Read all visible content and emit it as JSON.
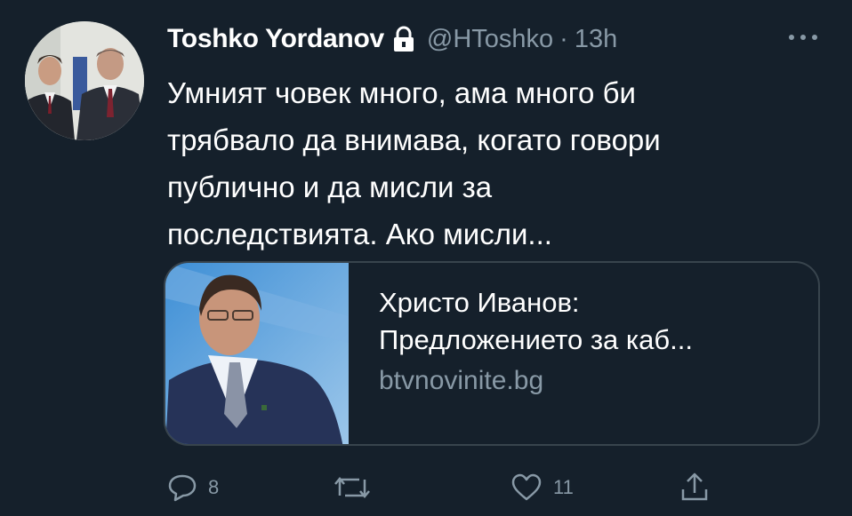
{
  "tweet": {
    "author": {
      "display_name": "Toshko Yordanov",
      "handle": "@HToshko",
      "separator": "·",
      "time": "13h",
      "protected_icon": "lock-icon",
      "avatar": "profile-photo"
    },
    "text_lines": [
      "Умният човек много, ама много би",
      "трябвало да внимава, когато говори",
      "публично и да мисли за",
      "последствията. Ако мисли..."
    ],
    "more_icon": "ellipsis-icon",
    "card": {
      "title_lines": [
        "Христо Иванов:",
        "Предложението за каб..."
      ],
      "domain": "btvnovinite.bg",
      "thumbnail": "news-photo"
    },
    "actions": {
      "reply_count": "8",
      "retweet_count": "",
      "like_count": "11",
      "reply_icon": "reply-icon",
      "retweet_icon": "retweet-icon",
      "like_icon": "heart-icon",
      "share_icon": "share-icon"
    }
  },
  "colors": {
    "background": "#15202b",
    "text": "#ffffff",
    "secondary": "#8899a6",
    "border": "#38444d"
  }
}
